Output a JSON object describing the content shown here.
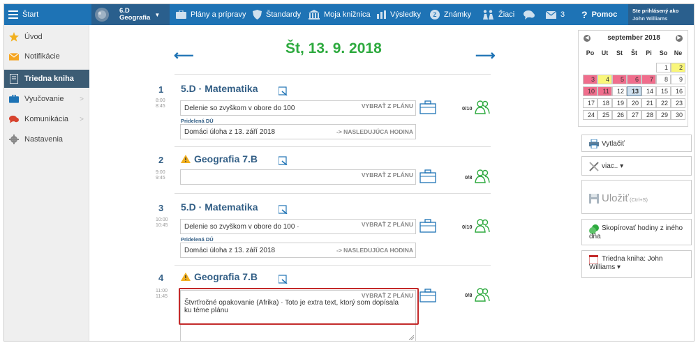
{
  "topbar": {
    "start_label": "Štart",
    "class_label_line1": "6.D",
    "class_label_line2": "Geografia",
    "plans_label": "Plány a prípravy",
    "standards_label": "Štandardy",
    "library_label": "Moja knižnica",
    "results_label": "Výsledky",
    "grades_label": "Známky",
    "students_label": "Žiaci",
    "messages_count": "3",
    "help_label": "Pomoc",
    "user_line1": "Ste prihlásený ako",
    "user_line2": "John Williams",
    "color": "#1e73b5"
  },
  "sidebar": {
    "items": [
      {
        "label": "Úvod",
        "icon": "star-icon"
      },
      {
        "label": "Notifikácie",
        "icon": "envelope-icon"
      },
      {
        "label": "Triedna kniha",
        "icon": "book-icon"
      },
      {
        "label": "Vyučovanie",
        "icon": "briefcase-icon"
      },
      {
        "label": "Komunikácia",
        "icon": "chat-icon"
      },
      {
        "label": "Nastavenia",
        "icon": "gear-icon"
      }
    ]
  },
  "main": {
    "date_title": "Št, 13. 9. 2018",
    "lessons": [
      {
        "number": "1",
        "time_start": "8:00",
        "time_end": "8:45",
        "subject": "5.D · Matematika",
        "warning": false,
        "topic": "Delenie so zvyškom v obore do 100",
        "select_plan_label": "VYBRAŤ Z PLÁNU",
        "count": "0/10",
        "homework_label": "Pridelená DÚ",
        "homework": "Domáci úloha z 13. září 2018",
        "homework_right": "-> NASLEDUJÚCA HODINA"
      },
      {
        "number": "2",
        "time_start": "9:00",
        "time_end": "9:45",
        "subject": "Geografia  7.B",
        "warning": true,
        "topic": "",
        "select_plan_label": "VYBRAŤ Z PLÁNU",
        "count": "0/8"
      },
      {
        "number": "3",
        "time_start": "10:00",
        "time_end": "10:45",
        "subject": "5.D · Matematika",
        "warning": false,
        "topic": "Delenie so zvyškom v obore do 100 ·",
        "select_plan_label": "VYBRAŤ Z PLÁNU",
        "count": "0/10",
        "homework_label": "Pridelená DÚ",
        "homework": "Domáci úloha z 13. září 2018",
        "homework_right": "-> NASLEDUJÚCA HODINA"
      },
      {
        "number": "4",
        "time_start": "11:00",
        "time_end": "11:45",
        "subject": "Geografia  7.B",
        "warning": true,
        "topic": "Štvrťročné opakovanie (Afrika) · Toto je extra text, ktorý som dopísala ku téme plánu",
        "select_plan_label": "VYBRAŤ Z PLÁNU",
        "count": "0/8"
      }
    ]
  },
  "calendar": {
    "title": "september 2018",
    "weekdays": [
      "Po",
      "Ut",
      "St",
      "Št",
      "Pi",
      "So",
      "Ne"
    ],
    "weeks": [
      [
        "",
        "",
        "",
        "",
        "",
        "1",
        "2"
      ],
      [
        "3",
        "4",
        "5",
        "6",
        "7",
        "8",
        "9"
      ],
      [
        "10",
        "11",
        "12",
        "13",
        "14",
        "15",
        "16"
      ],
      [
        "17",
        "18",
        "19",
        "20",
        "21",
        "22",
        "23"
      ],
      [
        "24",
        "25",
        "26",
        "27",
        "28",
        "29",
        "30"
      ]
    ],
    "today": "13",
    "highlight_pink": [
      "3",
      "5",
      "6",
      "7",
      "10",
      "11"
    ],
    "highlight_yellow": [
      "2",
      "4"
    ]
  },
  "actions": {
    "print_label": "Vytlačiť",
    "more_label": "viac.. ▾",
    "save_label": "Uložiť",
    "save_shortcut": "(Ctrl+S)",
    "copy_label": "Skopírovať hodiny z iného dňa",
    "book_label": "Triedna kniha: John Williams ▾"
  }
}
